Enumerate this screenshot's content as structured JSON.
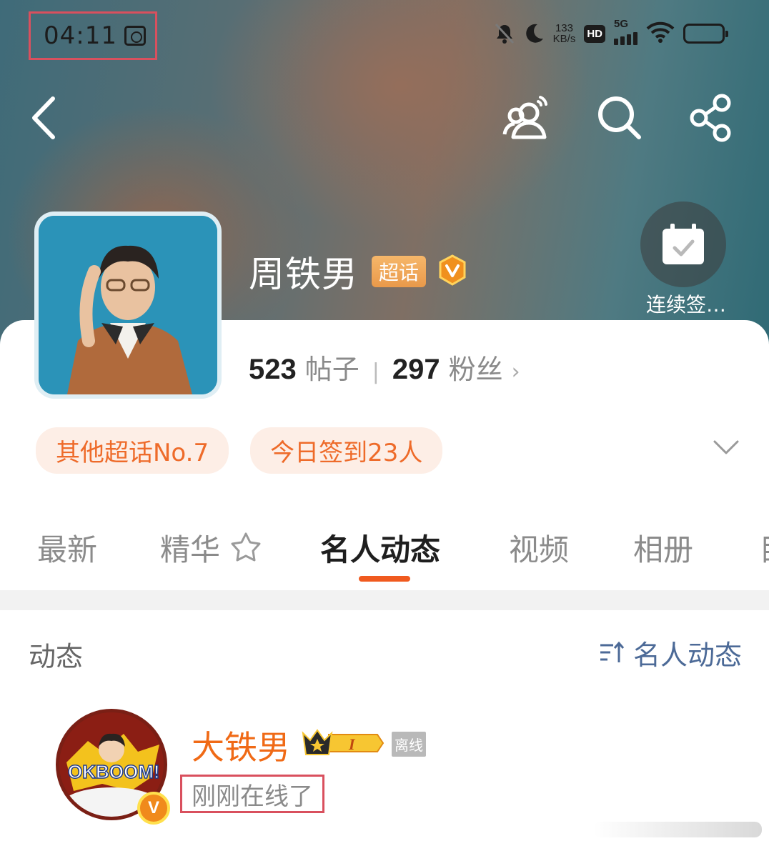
{
  "status_bar": {
    "time": "04:11",
    "net_speed_value": "133",
    "net_speed_unit": "KB/s",
    "hd_label": "HD",
    "network_label": "5G"
  },
  "header": {
    "checkin_label": "连续签…"
  },
  "topic": {
    "name": "周铁男",
    "super_badge": "超话",
    "posts_count": "523",
    "posts_label": "帖子",
    "fans_count": "297",
    "fans_label": "粉丝",
    "tags": [
      "其他超话No.7",
      "今日签到23人"
    ]
  },
  "tabs": [
    "最新",
    "精华",
    "名人动态",
    "视频",
    "相册",
    "目"
  ],
  "active_tab": "名人动态",
  "feed": {
    "section_title": "动态",
    "sort_label": "名人动态",
    "user": {
      "name": "大铁男",
      "level": "I",
      "offline_badge": "离线",
      "status": "刚刚在线了",
      "avatar_text": "OKBOOM!"
    }
  },
  "colors": {
    "accent": "#f05a1f",
    "tag_bg": "#fdeee6",
    "username": "#f06a16",
    "sort_blue": "#4c6a97",
    "highlight_box": "#d9505e"
  }
}
